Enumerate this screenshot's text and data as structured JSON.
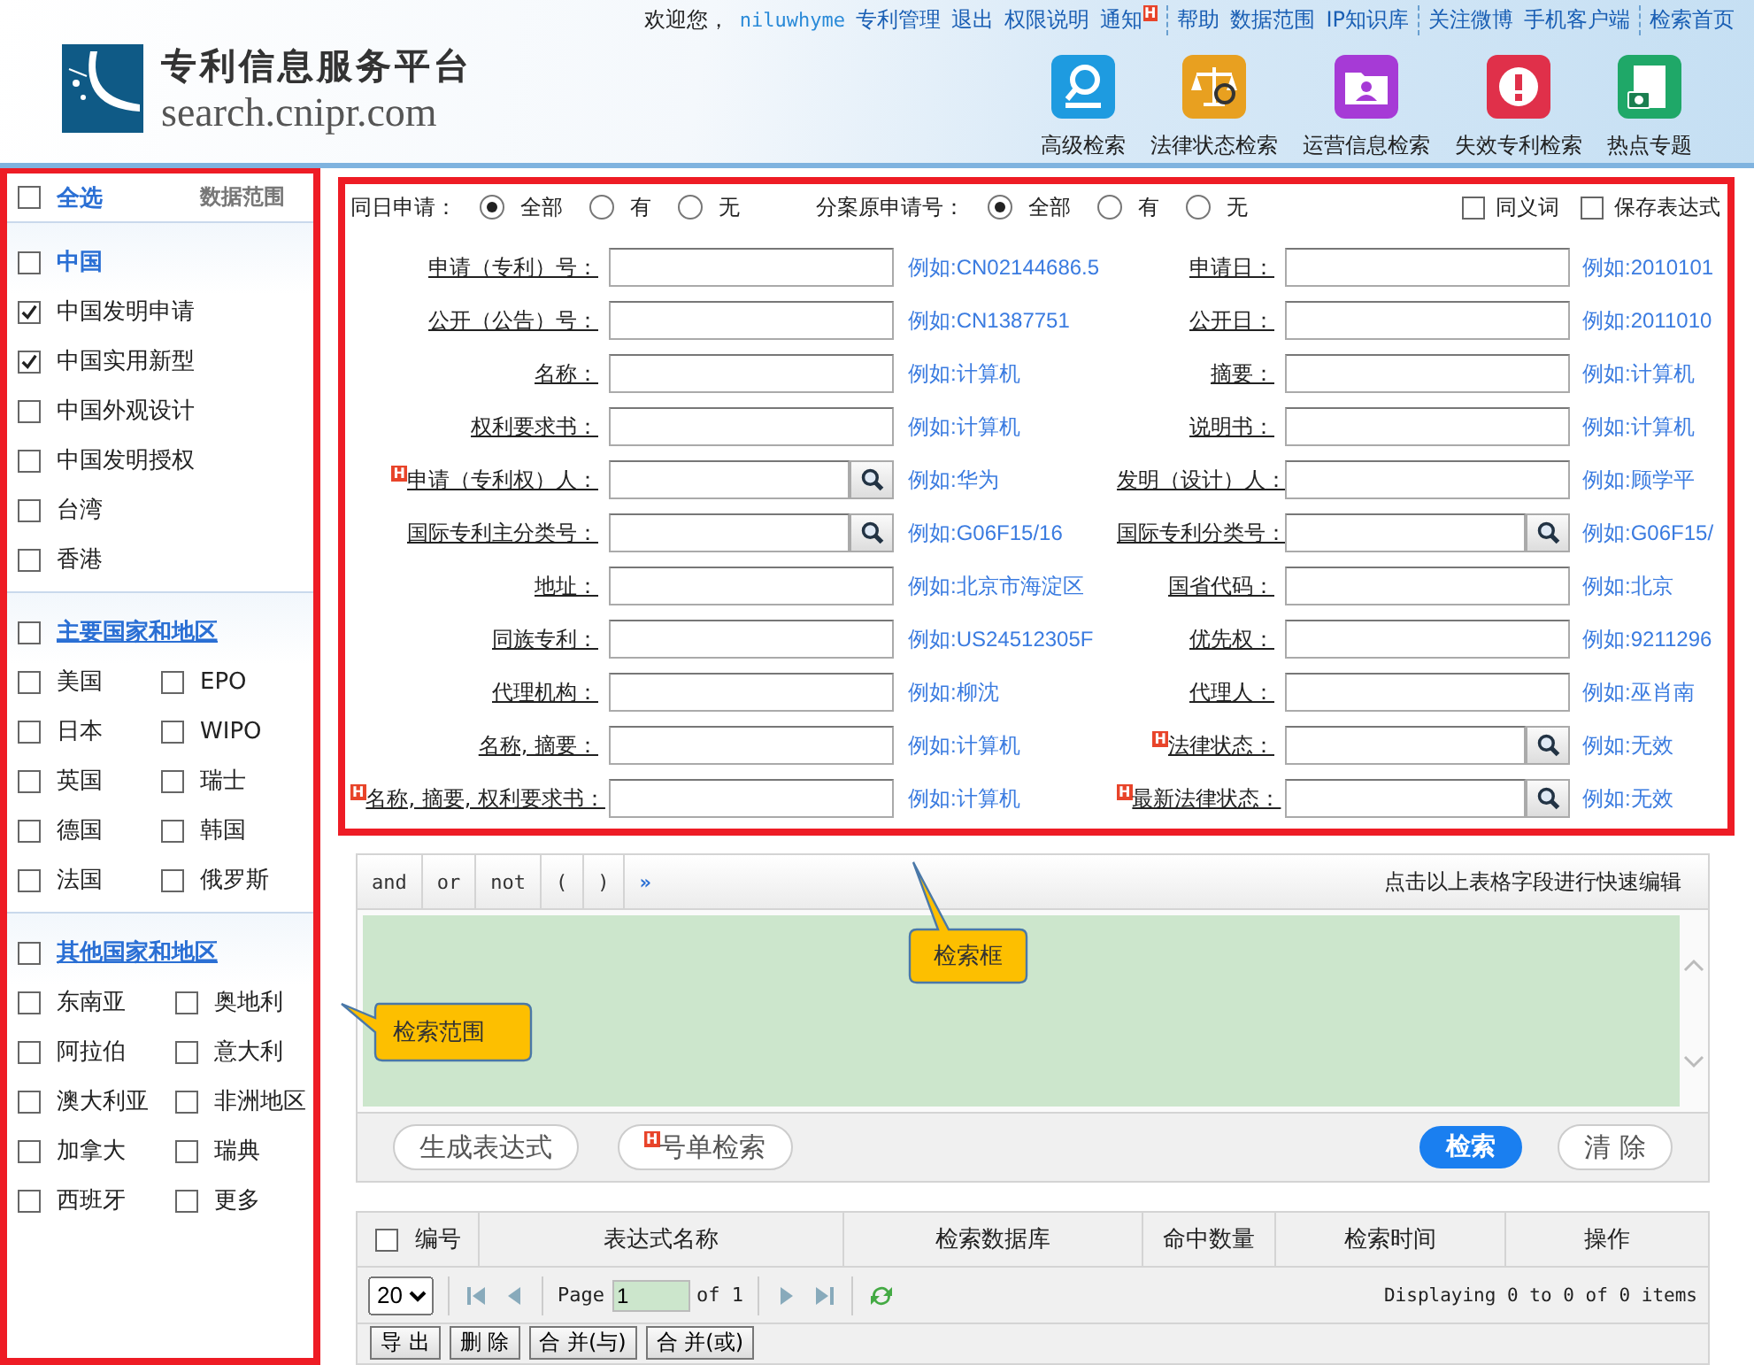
{
  "header": {
    "welcome": "欢迎您，",
    "user": "niluwhyme",
    "link_groups": [
      [
        {
          "label": "专利管理"
        },
        {
          "label": "退出"
        },
        {
          "label": "权限说明"
        },
        {
          "label": "通知",
          "badge": "H"
        }
      ],
      [
        {
          "label": "帮助"
        },
        {
          "label": "数据范围"
        },
        {
          "label": "IP知识库"
        }
      ],
      [
        {
          "label": "关注微博"
        },
        {
          "label": "手机客户端"
        }
      ],
      [
        {
          "label": "检索首页"
        }
      ]
    ],
    "logo": {
      "title": "专利信息服务平台",
      "domain": "search.cnipr.com"
    },
    "tools": [
      {
        "label": "高级检索",
        "kind": "magnifier",
        "color": "#1e9be0"
      },
      {
        "label": "法律状态检索",
        "kind": "scales",
        "color": "#e8a020"
      },
      {
        "label": "运营信息检索",
        "kind": "folder",
        "color": "#a63ad6"
      },
      {
        "label": "失效专利检索",
        "kind": "alert",
        "color": "#e0304a"
      },
      {
        "label": "热点专题",
        "kind": "photo",
        "color": "#1fa868"
      }
    ]
  },
  "sidebar": {
    "select_all": {
      "label": "全选",
      "checked": false
    },
    "data_range": "数据范围",
    "groups": [
      {
        "title": "中国",
        "checked": false,
        "kind": "single",
        "items": [
          {
            "label": "中国发明申请",
            "checked": true
          },
          {
            "label": "中国实用新型",
            "checked": true
          },
          {
            "label": "中国外观设计",
            "checked": false
          },
          {
            "label": "中国发明授权",
            "checked": false
          },
          {
            "label": "台湾",
            "checked": false
          },
          {
            "label": "香港",
            "checked": false
          }
        ]
      },
      {
        "title": "主要国家和地区",
        "checked": false,
        "kind": "double",
        "items": [
          {
            "label": "美国",
            "checked": false
          },
          {
            "label": "EPO",
            "checked": false
          },
          {
            "label": "日本",
            "checked": false
          },
          {
            "label": "WIPO",
            "checked": false
          },
          {
            "label": "英国",
            "checked": false
          },
          {
            "label": "瑞士",
            "checked": false
          },
          {
            "label": "德国",
            "checked": false
          },
          {
            "label": "韩国",
            "checked": false
          },
          {
            "label": "法国",
            "checked": false
          },
          {
            "label": "俄罗斯",
            "checked": false
          }
        ]
      },
      {
        "title": "其他国家和地区",
        "checked": false,
        "kind": "double",
        "items": [
          {
            "label": "东南亚",
            "checked": false
          },
          {
            "label": "奥地利",
            "checked": false
          },
          {
            "label": "阿拉伯",
            "checked": false
          },
          {
            "label": "意大利",
            "checked": false
          },
          {
            "label": "澳大利亚",
            "checked": false
          },
          {
            "label": "非洲地区",
            "checked": false
          },
          {
            "label": "加拿大",
            "checked": false
          },
          {
            "label": "瑞典",
            "checked": false
          },
          {
            "label": "西班牙",
            "checked": false
          },
          {
            "label": "更多",
            "checked": false
          }
        ]
      }
    ]
  },
  "form": {
    "options": [
      {
        "label": "同日申请：",
        "choices": [
          {
            "label": "全部",
            "selected": true
          },
          {
            "label": "有",
            "selected": false
          },
          {
            "label": "无",
            "selected": false
          }
        ]
      },
      {
        "label": "分案原申请号：",
        "choices": [
          {
            "label": "全部",
            "selected": true
          },
          {
            "label": "有",
            "selected": false
          },
          {
            "label": "无",
            "selected": false
          }
        ]
      }
    ],
    "toggles": [
      {
        "label": "同义词",
        "checked": false
      },
      {
        "label": "保存表达式",
        "checked": false
      }
    ],
    "rows": [
      {
        "left": {
          "label": "申请（专利）号：",
          "example": "例如:CN02144686.5",
          "lookup": false
        },
        "right": {
          "label": "申请日：",
          "example": "例如:2010101",
          "lookup": false
        }
      },
      {
        "left": {
          "label": "公开（公告）号：",
          "example": "例如:CN1387751",
          "lookup": false
        },
        "right": {
          "label": "公开日：",
          "example": "例如:2011010",
          "lookup": false
        }
      },
      {
        "left": {
          "label": "名称：",
          "example": "例如:计算机",
          "lookup": false
        },
        "right": {
          "label": "摘要：",
          "example": "例如:计算机",
          "lookup": false
        }
      },
      {
        "left": {
          "label": "权利要求书：",
          "example": "例如:计算机",
          "lookup": false
        },
        "right": {
          "label": "说明书：",
          "example": "例如:计算机",
          "lookup": false
        }
      },
      {
        "left": {
          "label": "申请（专利权）人：",
          "example": "例如:华为",
          "lookup": true,
          "badge": "H"
        },
        "right": {
          "label": "发明（设计）人：",
          "example": "例如:顾学平",
          "lookup": false
        }
      },
      {
        "left": {
          "label": "国际专利主分类号：",
          "example": "例如:G06F15/16",
          "lookup": true
        },
        "right": {
          "label": "国际专利分类号：",
          "example": "例如:G06F15/",
          "lookup": true
        }
      },
      {
        "left": {
          "label": "地址：",
          "example": "例如:北京市海淀区",
          "lookup": false
        },
        "right": {
          "label": "国省代码：",
          "example": "例如:北京",
          "lookup": false
        }
      },
      {
        "left": {
          "label": "同族专利：",
          "example": "例如:US24512305F",
          "lookup": false
        },
        "right": {
          "label": "优先权：",
          "example": "例如:9211296",
          "lookup": false
        }
      },
      {
        "left": {
          "label": "代理机构：",
          "example": "例如:柳沈",
          "lookup": false
        },
        "right": {
          "label": "代理人：",
          "example": "例如:巫肖南",
          "lookup": false
        }
      },
      {
        "left": {
          "label": "名称, 摘要：",
          "example": "例如:计算机",
          "lookup": false
        },
        "right": {
          "label": "法律状态：",
          "example": "例如:无效",
          "lookup": true,
          "badge": "H"
        }
      },
      {
        "left": {
          "label": "名称, 摘要, 权利要求书：",
          "example": "例如:计算机",
          "lookup": false,
          "badge": "H"
        },
        "right": {
          "label": "最新法律状态：",
          "example": "例如:无效",
          "lookup": true,
          "badge": "H"
        }
      }
    ]
  },
  "editor": {
    "operators": [
      "and",
      "or",
      "not",
      "(",
      ")",
      "»"
    ],
    "hint": "点击以上表格字段进行快速编辑",
    "left_actions": [
      {
        "label": "生成表达式",
        "kind": "outline"
      },
      {
        "label": "号单检索",
        "kind": "outline",
        "badge": "H"
      }
    ],
    "right_actions": [
      {
        "label": "检索",
        "kind": "primary"
      },
      {
        "label": "清 除",
        "kind": "outline"
      }
    ]
  },
  "results": {
    "select_all": {
      "checked": false
    },
    "columns": [
      "编号",
      "表达式名称",
      "检索数据库",
      "命中数量",
      "检索时间",
      "操作"
    ],
    "page_size": "20",
    "page_label": "Page",
    "page": "1",
    "page_total": "of 1",
    "display": "Displaying 0 to 0 of 0 items",
    "buttons": [
      "导 出",
      "删 除",
      "合 并(与)",
      "合 并(或)"
    ]
  },
  "callouts": [
    {
      "label": "检索框",
      "kind": "up"
    },
    {
      "label": "检索范围",
      "kind": "left"
    }
  ]
}
